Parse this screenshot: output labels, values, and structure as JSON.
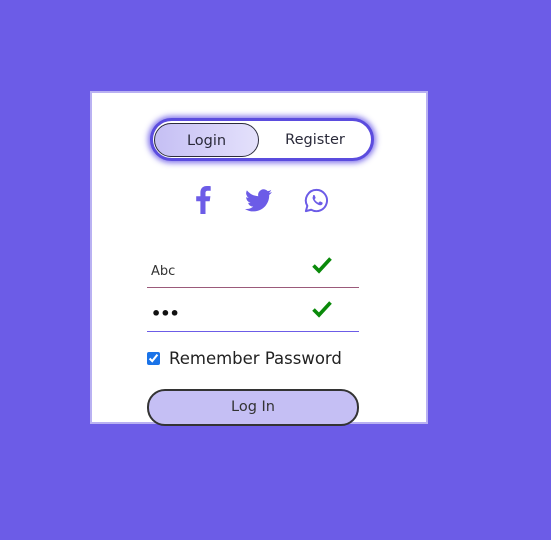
{
  "colors": {
    "background": "#6c5ce7",
    "accent": "#6c5ce7",
    "check": "#0a8a0a",
    "button_fill": "#c5bff4"
  },
  "tabs": {
    "login_label": "Login",
    "register_label": "Register",
    "active": "Login"
  },
  "social": [
    "facebook-icon",
    "twitter-icon",
    "whatsapp-icon"
  ],
  "form": {
    "username_value": "Abc",
    "password_value": "•••",
    "remember_label": "Remember Password",
    "remember_checked": true,
    "submit_label": "Log In"
  }
}
